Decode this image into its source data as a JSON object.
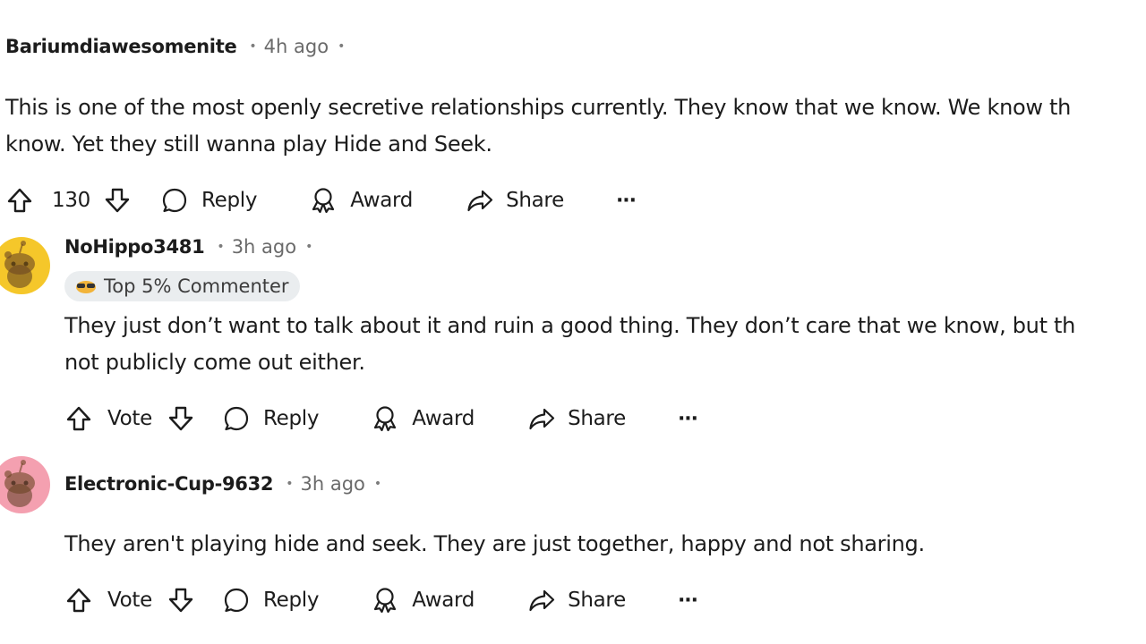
{
  "comments": [
    {
      "author": "Bariumdiawesomenite",
      "time": "4h ago",
      "text_lines": [
        "This is one of the most openly secretive relationships currently. They know that we know. We know th",
        "know. Yet they still wanna play Hide and Seek."
      ],
      "vote_label": "130",
      "reply_label": "Reply",
      "award_label": "Award",
      "share_label": "Share",
      "more_label": "···"
    },
    {
      "author": "NoHippo3481",
      "time": "3h ago",
      "badge": "Top 5% Commenter",
      "avatar_color": "#f5c72a",
      "text_lines": [
        "They just don’t want to talk about it and ruin a good thing. They don’t care that we know, but th",
        "not publicly come out either."
      ],
      "vote_label": "Vote",
      "reply_label": "Reply",
      "award_label": "Award",
      "share_label": "Share",
      "more_label": "···"
    },
    {
      "author": "Electronic-Cup-9632",
      "time": "3h ago",
      "avatar_color": "#f4a0b0",
      "text_lines": [
        "They aren't playing hide and seek. They are just together, happy and not sharing."
      ],
      "vote_label": "Vote",
      "reply_label": "Reply",
      "award_label": "Award",
      "share_label": "Share",
      "more_label": "···"
    }
  ],
  "icons": {
    "upvote": "upvote-icon",
    "downvote": "downvote-icon",
    "reply": "reply-bubble-icon",
    "award": "award-icon",
    "share": "share-arrow-icon",
    "more": "more-dots-icon"
  }
}
